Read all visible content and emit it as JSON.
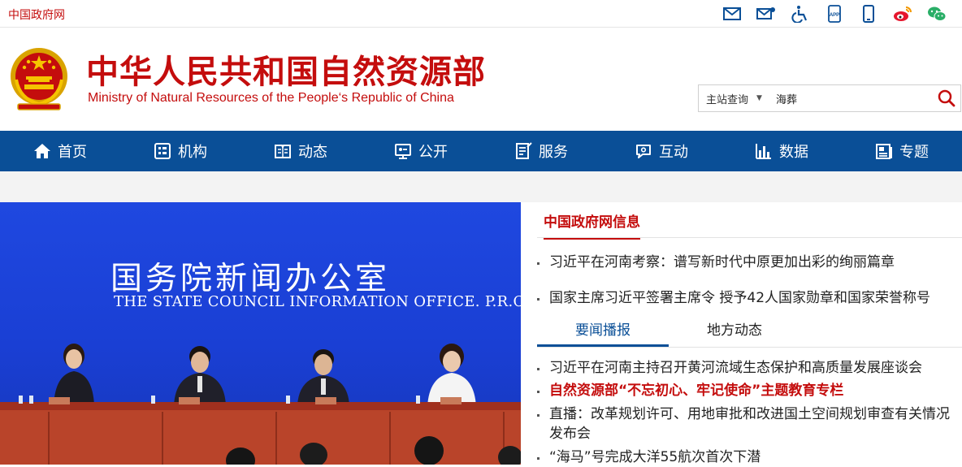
{
  "topbar": {
    "gov_link": "中国政府网",
    "icons": [
      "mail-icon",
      "mail-settings-icon",
      "accessibility-icon",
      "app-icon",
      "mobile-icon",
      "weibo-icon",
      "wechat-icon"
    ],
    "app_label": "APP"
  },
  "header": {
    "title": "中华人民共和国自然资源部",
    "subtitle": "Ministry of Natural Resources of the People‘s Republic of China"
  },
  "search": {
    "scope": "主站查询",
    "value": "海葬"
  },
  "nav": {
    "items": [
      {
        "label": "首页",
        "icon": "home-icon"
      },
      {
        "label": "机构",
        "icon": "organization-icon"
      },
      {
        "label": "动态",
        "icon": "news-icon"
      },
      {
        "label": "公开",
        "icon": "disclosure-icon"
      },
      {
        "label": "服务",
        "icon": "service-icon"
      },
      {
        "label": "互动",
        "icon": "interaction-icon"
      },
      {
        "label": "数据",
        "icon": "data-icon"
      },
      {
        "label": "专题",
        "icon": "topic-icon"
      }
    ]
  },
  "photo": {
    "cn_name": "国务院新闻办公室",
    "en_name": "THE STATE COUNCIL INFORMATION OFFICE. P.R.C."
  },
  "panel": {
    "title": "中国政府网信息",
    "top_news": [
      "习近平在河南考察：谱写新时代中原更加出彩的绚丽篇章",
      "国家主席习近平签署主席令 授予42人国家勋章和国家荣誉称号"
    ],
    "tabs": [
      "要闻播报",
      "地方动态"
    ],
    "tab_news": [
      {
        "text": "习近平在河南主持召开黄河流域生态保护和高质量发展座谈会",
        "red": false
      },
      {
        "text": "自然资源部“不忘初心、牢记使命”主题教育专栏",
        "red": true
      },
      {
        "text": "直播：改革规划许可、用地审批和改进国土空间规划审查有关情况发布会",
        "red": false
      },
      {
        "text": "“海马”号完成大洋55航次首次下潜",
        "red": false
      }
    ]
  },
  "colors": {
    "brand_red": "#c40d0d",
    "nav_blue": "#0a4f97",
    "photo_blue": "#1f48e0"
  }
}
